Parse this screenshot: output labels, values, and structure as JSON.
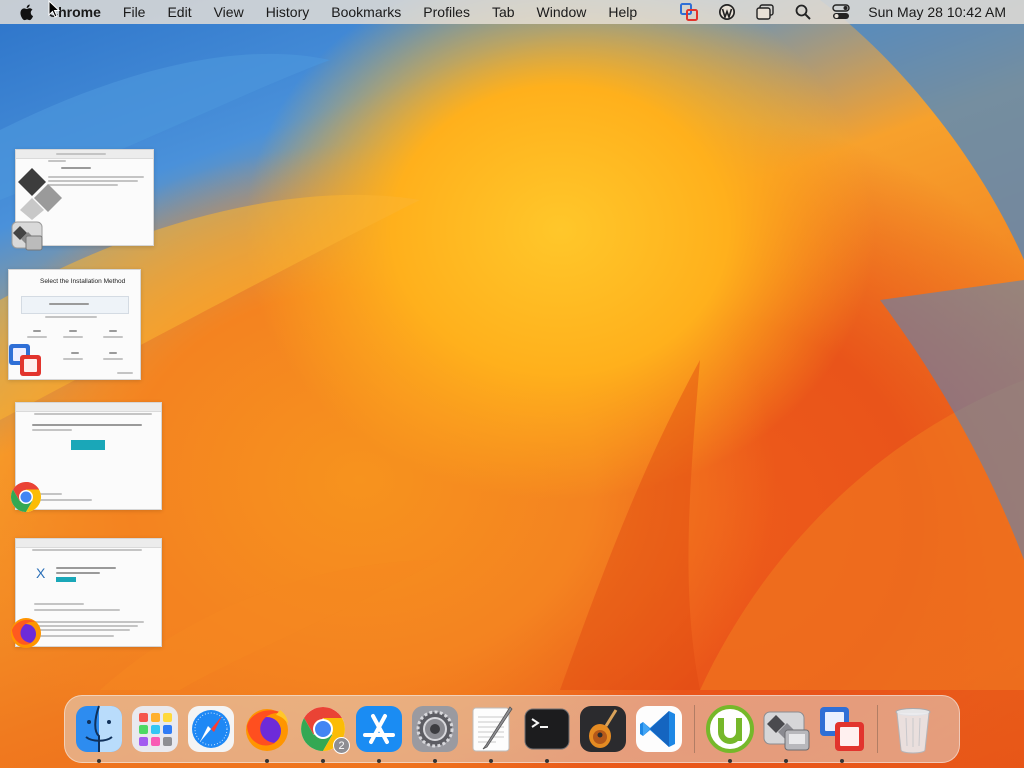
{
  "menubar": {
    "app_name": "Chrome",
    "items": [
      "File",
      "Edit",
      "View",
      "History",
      "Bookmarks",
      "Profiles",
      "Tab",
      "Window",
      "Help"
    ],
    "clock": "Sun May 28  10:42 AM",
    "status_icons": [
      "vmware-fusion-icon",
      "wordpress-icon",
      "window-stack-icon",
      "spotlight-search-icon",
      "control-center-icon"
    ]
  },
  "minimized_windows": [
    {
      "app": "Boot Camp Assistant",
      "icon": "bootcamp-icon"
    },
    {
      "app": "VMware Fusion",
      "icon": "vmware-fusion-icon",
      "heading": "Select the Installation Method"
    },
    {
      "app": "Google Chrome",
      "icon": "chrome-icon"
    },
    {
      "app": "Firefox",
      "icon": "firefox-icon"
    }
  ],
  "dock": {
    "items": [
      {
        "name": "finder",
        "running": true
      },
      {
        "name": "launchpad",
        "running": false
      },
      {
        "name": "safari",
        "running": false
      },
      {
        "name": "firefox",
        "running": true
      },
      {
        "name": "chrome",
        "running": true,
        "badge": "2"
      },
      {
        "name": "app-store",
        "running": true
      },
      {
        "name": "system-preferences",
        "running": true
      },
      {
        "name": "textedit",
        "running": true
      },
      {
        "name": "terminal",
        "running": true
      },
      {
        "name": "garageband",
        "running": false
      },
      {
        "name": "vscode",
        "running": false
      },
      {
        "name": "utorrent",
        "running": true
      },
      {
        "name": "bootcamp",
        "running": true
      },
      {
        "name": "vmware-fusion",
        "running": true
      },
      {
        "name": "trash",
        "running": false
      }
    ]
  }
}
